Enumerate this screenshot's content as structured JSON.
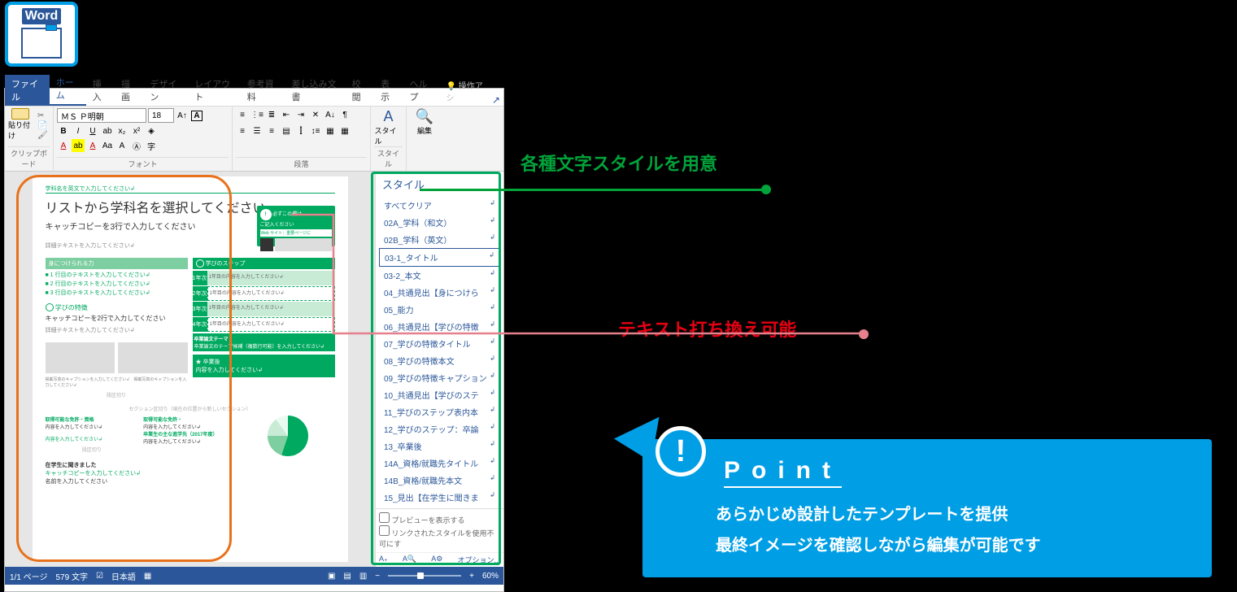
{
  "word_icon_label": "Word",
  "ribbon": {
    "tabs": [
      "ファイル",
      "ホーム",
      "挿入",
      "描画",
      "デザイン",
      "レイアウト",
      "参考資料",
      "差し込み文書",
      "校閲",
      "表示",
      "ヘルプ"
    ],
    "active_tab": "ホーム",
    "hint": "操作アシ",
    "groups": {
      "clipboard": "クリップボード",
      "font": "フォント",
      "paragraph": "段落",
      "styles": "スタイル",
      "edit": "編集"
    },
    "paste_label": "貼り付け",
    "font_name": "ＭＳ Ｐ明朝",
    "font_size": "18",
    "styles_btn": "スタイル",
    "edit_btn": "編集"
  },
  "styles_pane": {
    "title": "スタイル",
    "items": [
      "すべてクリア",
      "02A_学科（和文）",
      "02B_学科（英文）",
      "03-1_タイトル",
      "03-2_本文",
      "04_共通見出【身につけら",
      "05_能力",
      "06_共通見出【学びの特徴",
      "07_学びの特徴タイトル",
      "08_学びの特徴本文",
      "09_学びの特徴キャプション",
      "10_共通見出【学びのステ",
      "11_学びのステップ表内本",
      "12_学びのステップ：卒論",
      "13_卒業後",
      "14A_資格/就職先タイトル",
      "14B_資格/就職先本文",
      "15_見出【在学生に聞きま"
    ],
    "selected_index": 3,
    "chk_preview": "プレビューを表示する",
    "chk_linked": "リンクされたスタイルを使用不可にす",
    "options": "オプション..."
  },
  "document": {
    "dept_placeholder": "学科名を英文で入力してください↲",
    "title": "リストから学科名を選択してください",
    "catch": "キャッチコピーを3行で入力してください",
    "badge_top": "必ずこの欄は",
    "badge_sub": "ご記入ください",
    "badge_web": "Web サイト：重要ページに",
    "detail": "詳細テキストを入力してください↲",
    "skills_head": "身につけられる力",
    "bullets": [
      "■ 1 行目のテキストを入力してください↲",
      "■ 2 行目のテキストを入力してください↲",
      "■ 3 行目のテキストを入力してください↲"
    ],
    "feature_head": "学びの特徴",
    "feature_catch": "キャッチコピーを2行で入力してください",
    "feature_detail": "詳細テキストを入力してください↲",
    "steps_head": "学びのステップ",
    "step_text": "1年目の内容を入力してください↲",
    "thesis_title": "卒業論文テーマ",
    "thesis_body": "卒業論文のテーマ候補（複数行可能）を入力してください↲",
    "caption": "掲載写真のキャプションを入力してください↲　掲載写真のキャプションを入力してください↲",
    "sec_break_label": "段区切り",
    "grad_head": "卒業後",
    "grad_body": "内容を入力してください↲",
    "sec_new": "セクション区切り（現在の位置から新しいセクション）",
    "cert_head": "取得可能な免許・資格",
    "cert_body": "内容を入力してください↲",
    "cert_head2": "取得可能な免許・",
    "career_head": "卒業生の主な進学先（2017年度）",
    "career_body": "内容を入力してください↲",
    "interview_head": "在学生に聞きました",
    "interview_catch": "キャッチコピーを入力してください↲",
    "name_prompt": "名前を入力してください"
  },
  "statusbar": {
    "page": "1/1 ページ",
    "words": "579 文字",
    "lang": "日本語",
    "zoom": "60%"
  },
  "callouts": {
    "styles": "各種文字スタイルを用意",
    "edit": "テキスト打ち換え可能"
  },
  "point": {
    "title": "Point",
    "line1": "あらかじめ設計したテンプレートを提供",
    "line2": "最終イメージを確認しながら編集が可能です"
  }
}
